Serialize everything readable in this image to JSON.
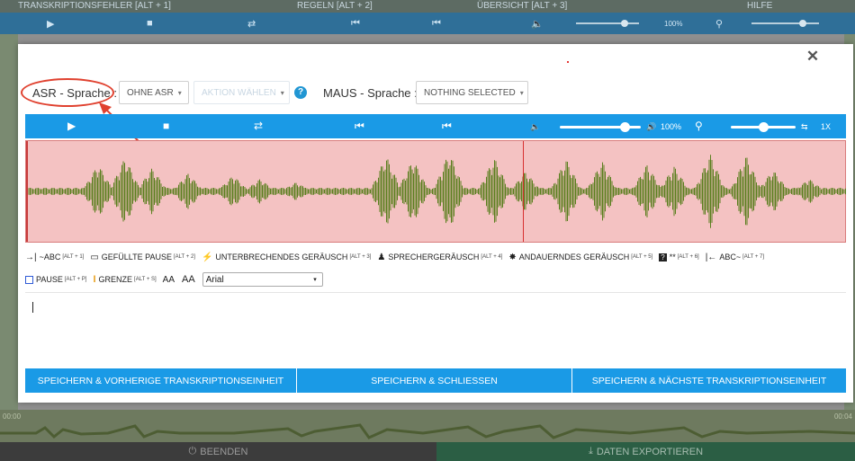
{
  "background": {
    "tabs": [
      "TRANSKRIPTIONSFEHLER [ALT + 1]",
      "REGELN [ALT + 2]",
      "ÜBERSICHT [ALT + 3]",
      "HILFE"
    ],
    "volume_label": "100%",
    "footer_left": "BEENDEN",
    "footer_right": "DATEN EXPORTIEREN",
    "time_left": "00:00",
    "time_right": "00:04"
  },
  "modal": {
    "close_label": "✕",
    "asr_label": "ASR - Sprache :",
    "asr_value": "OHNE ASR",
    "asr_second_value": "AKTION WÄHLEN",
    "help_label": "?",
    "maus_label": "MAUS - Sprache :",
    "maus_value": "NOTHING SELECTED",
    "player": {
      "volume": "100%",
      "speed": "1X",
      "volume_level": 0.8,
      "speed_level": 0.5
    },
    "toolbar": [
      {
        "icon": "→|",
        "label": "~ABC",
        "shortcut": "[ALT + 1]"
      },
      {
        "icon": "▭",
        "label": "GEFÜLLTE PAUSE",
        "shortcut": "[ALT + 2]"
      },
      {
        "icon": "⚡",
        "label": "UNTERBRECHENDES GERÄUSCH",
        "shortcut": "[ALT + 3]"
      },
      {
        "icon": "♟",
        "label": "SPRECHERGERÄUSCH",
        "shortcut": "[ALT + 4]"
      },
      {
        "icon": "✸",
        "label": "ANDAUERNDES GERÄUSCH",
        "shortcut": "[ALT + 5]"
      },
      {
        "icon": "?",
        "label": "**",
        "shortcut": "[ALT + 6]"
      },
      {
        "icon": "|←",
        "label": "ABC~",
        "shortcut": "[ALT + 7]"
      }
    ],
    "toolbar2": {
      "pause_label": "PAUSE",
      "pause_shortcut": "[ALT + P]",
      "border_label": "GRENZE",
      "border_shortcut": "[ALT + S]",
      "aa_small": "AA",
      "aa_large": "AA",
      "font_value": "Arial"
    },
    "buttons": {
      "prev": "SPEICHERN & VORHERIGE TRANSKRIPTIONSEINHEIT",
      "close": "SPEICHERN & SCHLIESSEN",
      "next": "SPEICHERN & NÄCHSTE TRANSKRIPTIONSEINHEIT"
    }
  },
  "colors": {
    "accent": "#1a9ae6",
    "waveform_bg": "#f4c2c2",
    "waveform": "#5a7f1e",
    "annotation": "#e0412f"
  }
}
